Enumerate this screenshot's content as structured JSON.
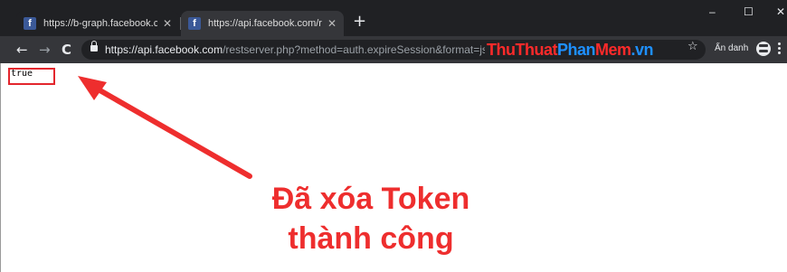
{
  "browser": {
    "tabs": [
      {
        "favicon": "f",
        "title": "https://b-graph.facebook.com/au",
        "close": "✕",
        "active": false
      },
      {
        "favicon": "f",
        "title": "https://api.facebook.com/restser",
        "close": "✕",
        "active": true
      }
    ],
    "new_tab": "+",
    "window_controls": {
      "minimize": "–",
      "maximize": "☐",
      "close": "✕"
    },
    "toolbar": {
      "back": "←",
      "forward": "→",
      "reload": "C",
      "url_host": "https://api.facebook.com",
      "url_path": "/restserver.php?method=auth.expireSession&format=json&acce",
      "bookmark_star": "☆",
      "incognito_label": "Ẩn danh"
    },
    "watermark": {
      "part1": "Thu",
      "part2": "Thuat",
      "part3": "Phan",
      "part4": "Mem",
      "part5": ".vn"
    },
    "colors": {
      "highlight": "#e3262d",
      "annotation": "#ee2e2e",
      "facebook": "#3b5998"
    },
    "icons": [
      "facebook-favicon",
      "close-icon",
      "plus-icon",
      "lock-icon",
      "star-icon",
      "incognito-icon",
      "menu-icon"
    ]
  },
  "page": {
    "response_text": "true",
    "annotation": {
      "line1": "Đã xóa Token",
      "line2": "thành công"
    }
  }
}
